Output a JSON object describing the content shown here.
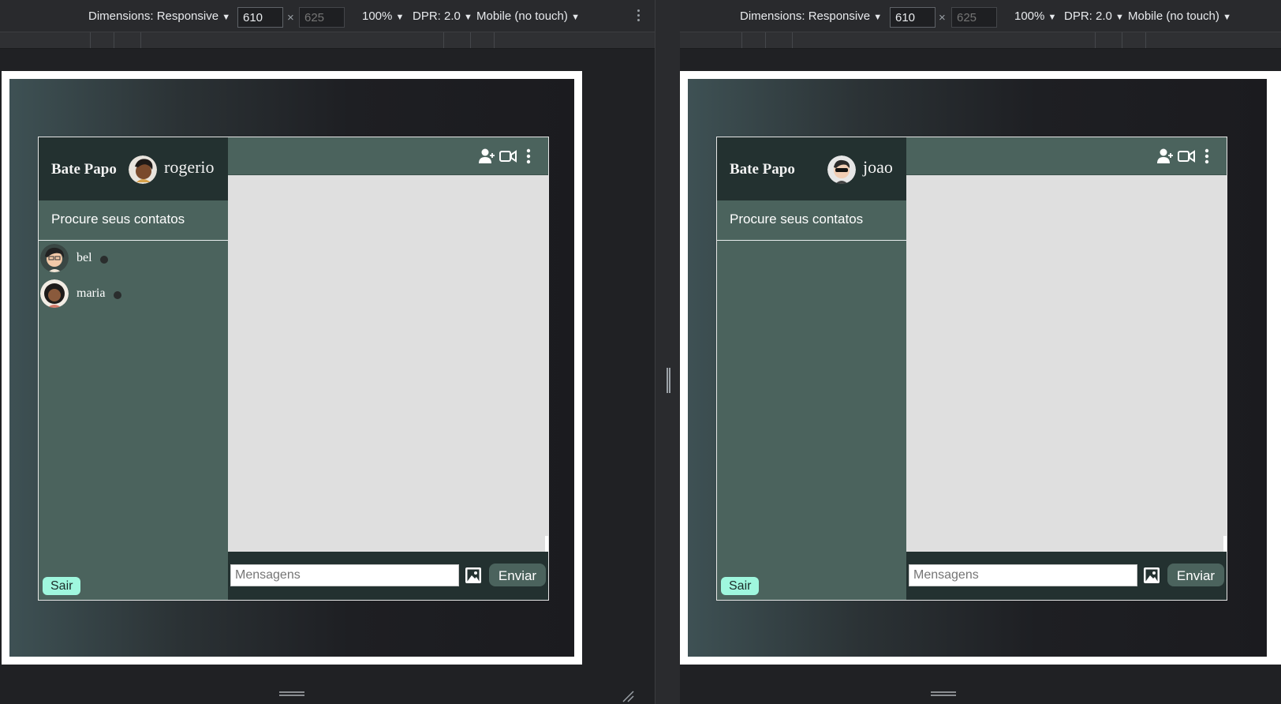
{
  "devtools": {
    "dimensions_label": "Dimensions: Responsive",
    "width_value": "610",
    "height_placeholder": "625",
    "times": "×",
    "zoom": "100%",
    "dpr": "DPR: 2.0",
    "device": "Mobile (no touch)",
    "dropdown_arrow": "▼"
  },
  "panes": [
    {
      "app": {
        "brand": "Bate Papo",
        "username": "rogerio",
        "search_text": "Procure seus contatos",
        "contacts": [
          {
            "name": "bel"
          },
          {
            "name": "maria"
          }
        ],
        "logout_label": "Sair",
        "message_placeholder": "Mensagens",
        "send_label": "Enviar"
      }
    },
    {
      "app": {
        "brand": "Bate Papo",
        "username": "joao",
        "search_text": "Procure seus contatos",
        "contacts": [],
        "logout_label": "Sair",
        "message_placeholder": "Mensagens",
        "send_label": "Enviar"
      }
    }
  ],
  "colors": {
    "sidebar": "#4b635d",
    "header_dark": "#233130",
    "chat_bg": "#dfdfdf",
    "logout_button": "#9ff7de"
  },
  "icons": [
    "add-user-icon",
    "video-call-icon",
    "more-vertical-icon",
    "image-icon"
  ]
}
